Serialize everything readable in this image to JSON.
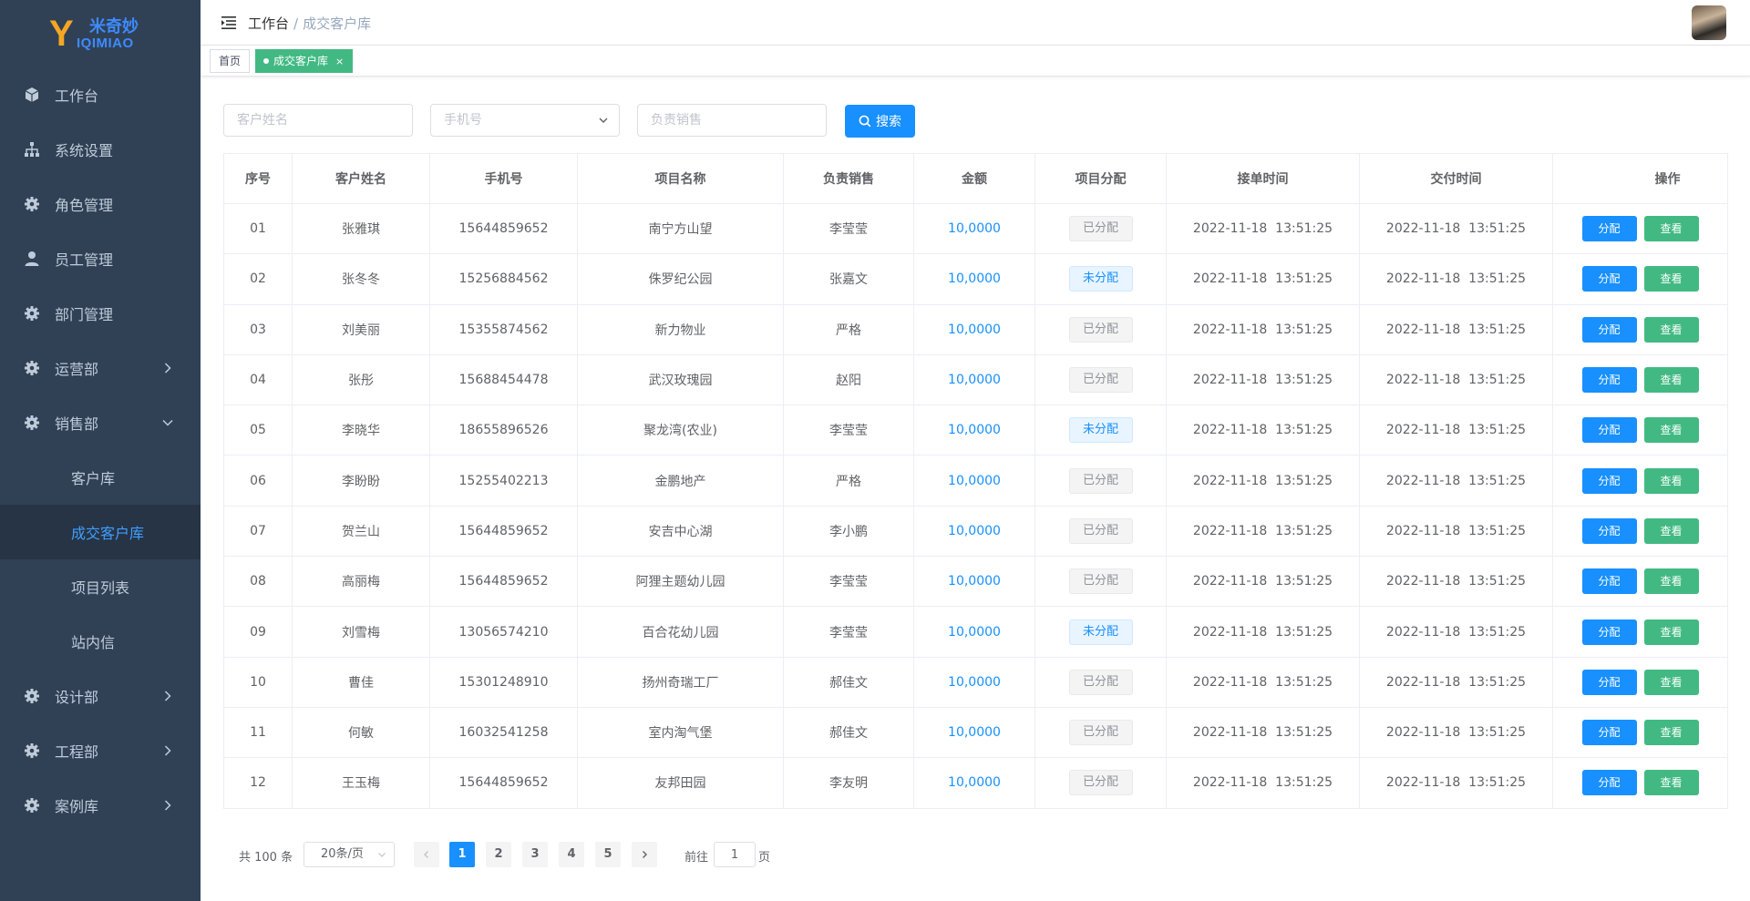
{
  "logo": {
    "letter": "Y",
    "cn_text": "米奇妙",
    "en_text": "IQIMIAO"
  },
  "sidebar": {
    "items": [
      {
        "label": "工作台",
        "icon": "cube-icon"
      },
      {
        "label": "系统设置",
        "icon": "sitemap-icon"
      },
      {
        "label": "角色管理",
        "icon": "gear-icon"
      },
      {
        "label": "员工管理",
        "icon": "user-icon"
      },
      {
        "label": "部门管理",
        "icon": "gear-icon"
      },
      {
        "label": "运营部",
        "icon": "gear-icon",
        "expandable": true
      },
      {
        "label": "销售部",
        "icon": "gear-icon",
        "expanded": true
      },
      {
        "label": "设计部",
        "icon": "gear-icon",
        "expandable": true
      },
      {
        "label": "工程部",
        "icon": "gear-icon",
        "expandable": true
      },
      {
        "label": "案例库",
        "icon": "gear-icon",
        "expandable": true
      }
    ],
    "sales_sub": [
      "客户库",
      "成交客户库",
      "项目列表",
      "站内信"
    ],
    "active_sub": "成交客户库"
  },
  "header": {
    "breadcrumb_root": "工作台",
    "breadcrumb_sep": "/",
    "breadcrumb_current": "成交客户库"
  },
  "tags": {
    "home": "首页",
    "current": "成交客户库",
    "close": "×"
  },
  "search": {
    "name_placeholder": "客户姓名",
    "phone_placeholder": "手机号",
    "sales_placeholder": "负责销售",
    "button": "搜索"
  },
  "table": {
    "headers": [
      "序号",
      "客户姓名",
      "手机号",
      "项目名称",
      "负责销售",
      "金额",
      "项目分配",
      "接单时间",
      "交付时间",
      "操作"
    ],
    "assign_label": "分配",
    "view_label": "查看",
    "rows": [
      {
        "no": "01",
        "name": "张雅琪",
        "phone": "15644859652",
        "project": "南宁方山望",
        "sales": "李莹莹",
        "amount": "10,0000",
        "status": "已分配",
        "assigned": true,
        "order_time": "2022-11-18  13:51:25",
        "deliver_time": "2022-11-18  13:51:25"
      },
      {
        "no": "02",
        "name": "张冬冬",
        "phone": "15256884562",
        "project": "侏罗纪公园",
        "sales": "张嘉文",
        "amount": "10,0000",
        "status": "未分配",
        "assigned": false,
        "order_time": "2022-11-18  13:51:25",
        "deliver_time": "2022-11-18  13:51:25"
      },
      {
        "no": "03",
        "name": "刘美丽",
        "phone": "15355874562",
        "project": "新力物业",
        "sales": "严格",
        "amount": "10,0000",
        "status": "已分配",
        "assigned": true,
        "order_time": "2022-11-18  13:51:25",
        "deliver_time": "2022-11-18  13:51:25"
      },
      {
        "no": "04",
        "name": "张彤",
        "phone": "15688454478",
        "project": "武汉玫瑰园",
        "sales": "赵阳",
        "amount": "10,0000",
        "status": "已分配",
        "assigned": true,
        "order_time": "2022-11-18  13:51:25",
        "deliver_time": "2022-11-18  13:51:25"
      },
      {
        "no": "05",
        "name": "李晓华",
        "phone": "18655896526",
        "project": "聚龙湾(农业)",
        "sales": "李莹莹",
        "amount": "10,0000",
        "status": "未分配",
        "assigned": false,
        "order_time": "2022-11-18  13:51:25",
        "deliver_time": "2022-11-18  13:51:25"
      },
      {
        "no": "06",
        "name": "李盼盼",
        "phone": "15255402213",
        "project": "金鹏地产",
        "sales": "严格",
        "amount": "10,0000",
        "status": "已分配",
        "assigned": true,
        "order_time": "2022-11-18  13:51:25",
        "deliver_time": "2022-11-18  13:51:25"
      },
      {
        "no": "07",
        "name": "贺兰山",
        "phone": "15644859652",
        "project": "安吉中心湖",
        "sales": "李小鹏",
        "amount": "10,0000",
        "status": "已分配",
        "assigned": true,
        "order_time": "2022-11-18  13:51:25",
        "deliver_time": "2022-11-18  13:51:25"
      },
      {
        "no": "08",
        "name": "高丽梅",
        "phone": "15644859652",
        "project": "阿狸主题幼儿园",
        "sales": "李莹莹",
        "amount": "10,0000",
        "status": "已分配",
        "assigned": true,
        "order_time": "2022-11-18  13:51:25",
        "deliver_time": "2022-11-18  13:51:25"
      },
      {
        "no": "09",
        "name": "刘雪梅",
        "phone": "13056574210",
        "project": "百合花幼儿园",
        "sales": "李莹莹",
        "amount": "10,0000",
        "status": "未分配",
        "assigned": false,
        "order_time": "2022-11-18  13:51:25",
        "deliver_time": "2022-11-18  13:51:25"
      },
      {
        "no": "10",
        "name": "曹佳",
        "phone": "15301248910",
        "project": "扬州奇瑞工厂",
        "sales": "郝佳文",
        "amount": "10,0000",
        "status": "已分配",
        "assigned": true,
        "order_time": "2022-11-18  13:51:25",
        "deliver_time": "2022-11-18  13:51:25"
      },
      {
        "no": "11",
        "name": "何敏",
        "phone": "16032541258",
        "project": "室内淘气堡",
        "sales": "郝佳文",
        "amount": "10,0000",
        "status": "已分配",
        "assigned": true,
        "order_time": "2022-11-18  13:51:25",
        "deliver_time": "2022-11-18  13:51:25"
      },
      {
        "no": "12",
        "name": "王玉梅",
        "phone": "15644859652",
        "project": "友邦田园",
        "sales": "李友明",
        "amount": "10,0000",
        "status": "已分配",
        "assigned": true,
        "order_time": "2022-11-18  13:51:25",
        "deliver_time": "2022-11-18  13:51:25"
      }
    ]
  },
  "pagination": {
    "total": "共 100 条",
    "page_size": "20条/页",
    "pages": [
      "1",
      "2",
      "3",
      "4",
      "5"
    ],
    "current": "1",
    "goto_label": "前往",
    "goto_value": "1",
    "goto_unit": "页"
  },
  "colors": {
    "sidebar_bg": "#304156",
    "sidebar_active_bg": "#263445",
    "accent": "#1890ff",
    "success": "#42b983"
  }
}
